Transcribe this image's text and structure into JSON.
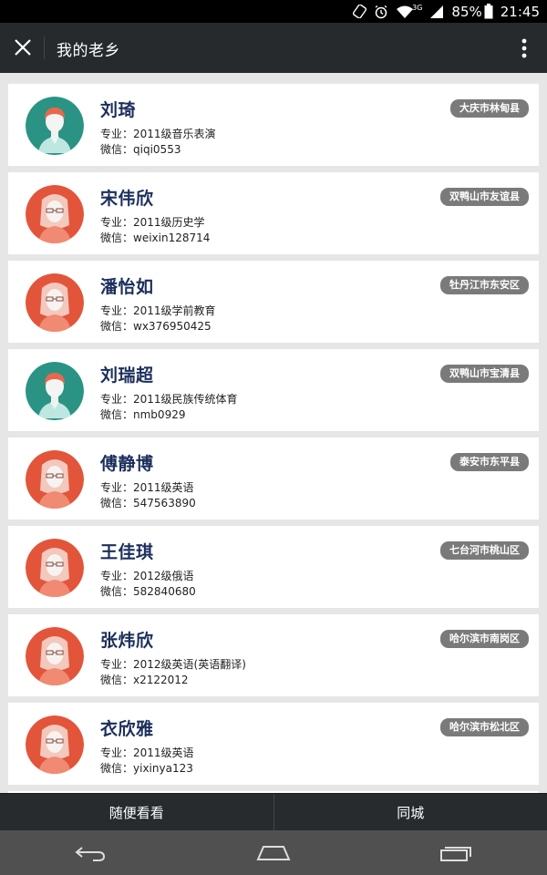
{
  "status_bar": {
    "battery": "85%",
    "time": "21:45",
    "network": "3G"
  },
  "header": {
    "title": "我的老乡"
  },
  "labels": {
    "major_prefix": "专业：",
    "wechat_prefix": "微信："
  },
  "contacts": [
    {
      "name": "刘琦",
      "major": "2011级音乐表演",
      "wechat": "qiqi0553",
      "location": "大庆市林甸县",
      "avatar": "male"
    },
    {
      "name": "宋伟欣",
      "major": "2011级历史学",
      "wechat": "weixin128714",
      "location": "双鸭山市友谊县",
      "avatar": "female"
    },
    {
      "name": "潘怡如",
      "major": "2011级学前教育",
      "wechat": "wx376950425",
      "location": "牡丹江市东安区",
      "avatar": "female"
    },
    {
      "name": "刘瑞超",
      "major": "2011级民族传统体育",
      "wechat": "nmb0929",
      "location": "双鸭山市宝清县",
      "avatar": "male"
    },
    {
      "name": "傅静博",
      "major": "2011级英语",
      "wechat": "547563890",
      "location": "泰安市东平县",
      "avatar": "female"
    },
    {
      "name": "王佳琪",
      "major": "2012级俄语",
      "wechat": "582840680",
      "location": "七台河市桃山区",
      "avatar": "female"
    },
    {
      "name": "张炜欣",
      "major": "2012级英语(英语翻译)",
      "wechat": "x2122012",
      "location": "哈尔滨市南岗区",
      "avatar": "female"
    },
    {
      "name": "衣欣雅",
      "major": "2011级英语",
      "wechat": "yixinya123",
      "location": "哈尔滨市松北区",
      "avatar": "female"
    }
  ],
  "tabs": [
    {
      "label": "随便看看"
    },
    {
      "label": "同城"
    }
  ],
  "colors": {
    "male_avatar_bg": "#2a9384",
    "female_avatar_bg": "#e2553a",
    "name": "#1b2f5c",
    "tag_bg": "#7a7a7a",
    "header_bg": "#262a2d"
  }
}
